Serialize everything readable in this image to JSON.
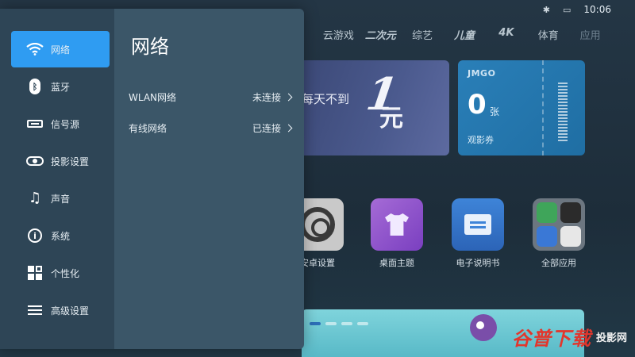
{
  "status_bar": {
    "bluetooth_icon": "bluetooth-icon",
    "screen_icon": "screen-icon",
    "time": "10:06"
  },
  "top_nav": [
    "云游戏",
    "二次元",
    "综艺",
    "儿童",
    "4K",
    "体育",
    "应用"
  ],
  "banner": {
    "text": "每天不到",
    "big": "1",
    "unit": "元"
  },
  "ticket_card": {
    "brand": "JMGO",
    "count": "0",
    "unit": "张",
    "label": "观影券"
  },
  "apps": [
    {
      "name": "安卓设置",
      "icon": "gear-icon"
    },
    {
      "name": "桌面主题",
      "icon": "shirt-icon"
    },
    {
      "name": "电子说明书",
      "icon": "manual-icon"
    },
    {
      "name": "全部应用",
      "icon": "apps-grid-icon"
    }
  ],
  "watermark": {
    "main": "谷普下载",
    "secondary": "投影网"
  },
  "settings": {
    "sidebar": [
      {
        "label": "网络",
        "icon": "wifi-icon",
        "active": true
      },
      {
        "label": "蓝牙",
        "icon": "bluetooth-icon"
      },
      {
        "label": "信号源",
        "icon": "input-source-icon"
      },
      {
        "label": "投影设置",
        "icon": "projector-icon"
      },
      {
        "label": "声音",
        "icon": "music-note-icon"
      },
      {
        "label": "系统",
        "icon": "info-icon"
      },
      {
        "label": "个性化",
        "icon": "personalize-icon"
      },
      {
        "label": "高级设置",
        "icon": "sliders-icon"
      }
    ],
    "panel": {
      "title": "网络",
      "rows": [
        {
          "label": "WLAN网络",
          "value": "未连接"
        },
        {
          "label": "有线网络",
          "value": "已连接"
        }
      ]
    }
  },
  "colors": {
    "accent": "#2f9cf2",
    "sidebar_bg": "#2e4556",
    "panel_bg": "#3b5668"
  }
}
